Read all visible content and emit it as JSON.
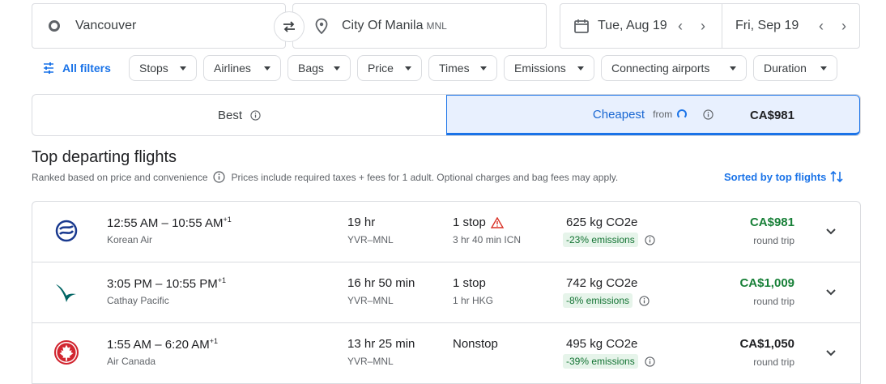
{
  "search": {
    "origin": "Vancouver",
    "destination": "City Of Manila",
    "destination_code": "MNL",
    "depart_date": "Tue, Aug 19",
    "return_date": "Fri, Sep 19"
  },
  "filters": {
    "all_filters": "All filters",
    "chips": [
      "Stops",
      "Airlines",
      "Bags",
      "Price",
      "Times",
      "Emissions",
      "Connecting airports",
      "Duration"
    ]
  },
  "tabs": {
    "best": "Best",
    "cheapest": "Cheapest",
    "cheapest_from": "from",
    "cheapest_price": "CA$981"
  },
  "section": {
    "title": "Top departing flights",
    "ranked": "Ranked based on price and convenience",
    "note": "Prices include required taxes + fees for 1 adult. Optional charges and bag fees may apply.",
    "sort": "Sorted by top flights"
  },
  "flights": [
    {
      "depart": "12:55 AM",
      "arrive": "10:55 AM",
      "day_offset": "+1",
      "airline": "Korean Air",
      "duration": "19 hr",
      "route": "YVR–MNL",
      "stops": "1 stop",
      "stop_info": "3 hr 40 min ICN",
      "co2": "625 kg CO2e",
      "emissions": "-23% emissions",
      "price": "CA$981",
      "trip_type": "round trip",
      "price_color": "#188038"
    },
    {
      "depart": "3:05 PM",
      "arrive": "10:55 PM",
      "day_offset": "+1",
      "airline": "Cathay Pacific",
      "duration": "16 hr 50 min",
      "route": "YVR–MNL",
      "stops": "1 stop",
      "stop_info": "1 hr HKG",
      "co2": "742 kg CO2e",
      "emissions": "-8% emissions",
      "price": "CA$1,009",
      "trip_type": "round trip",
      "price_color": "#188038"
    },
    {
      "depart": "1:55 AM",
      "arrive": "6:20 AM",
      "day_offset": "+1",
      "airline": "Air Canada",
      "duration": "13 hr 25 min",
      "route": "YVR–MNL",
      "stops": "Nonstop",
      "stop_info": "",
      "co2": "495 kg CO2e",
      "emissions": "-39% emissions",
      "price": "CA$1,050",
      "trip_type": "round trip",
      "price_color": "#202124"
    }
  ]
}
